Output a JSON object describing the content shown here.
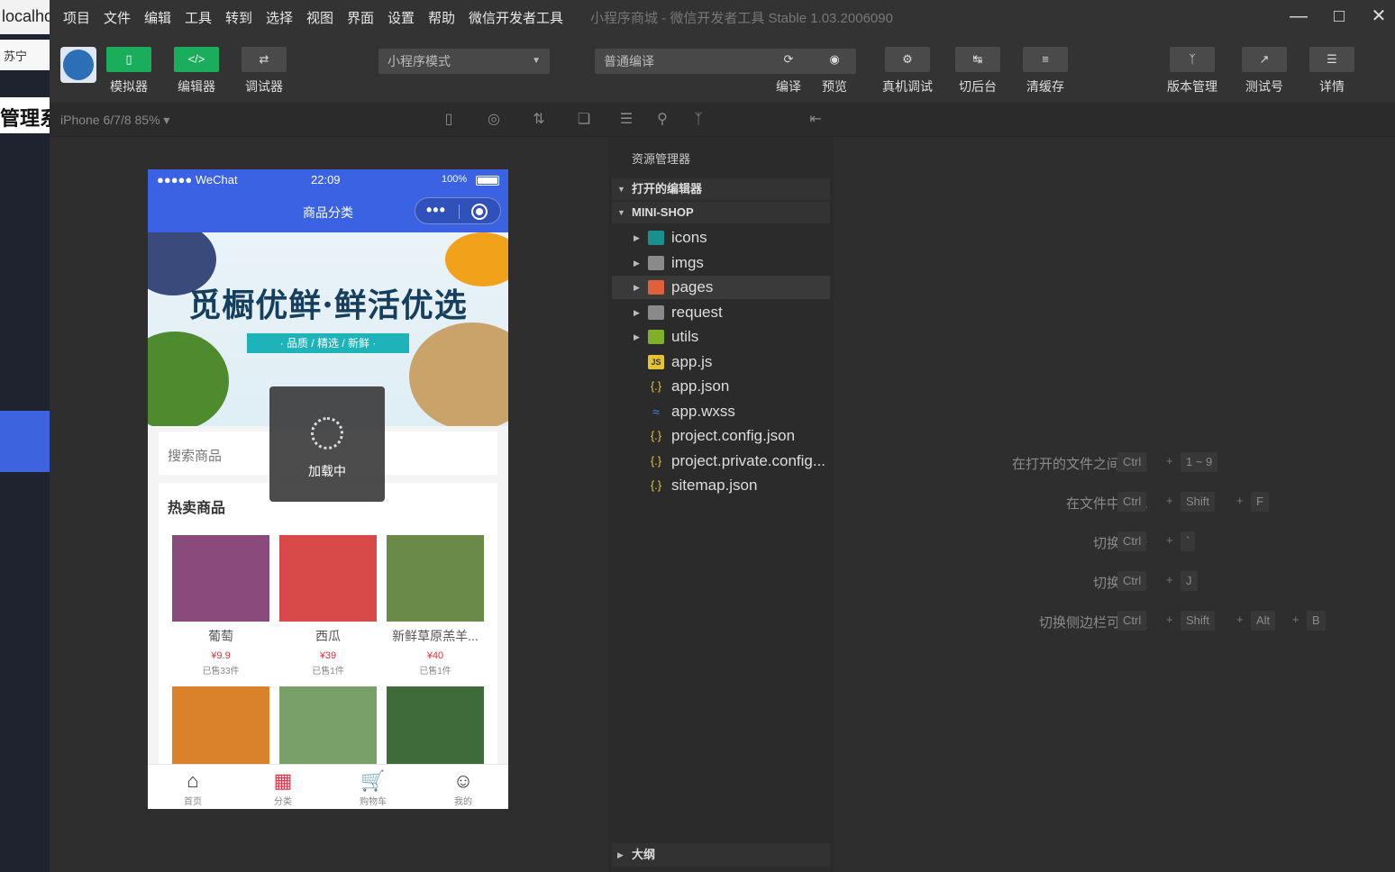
{
  "bg_window": {
    "tab_text": "localhost",
    "tab2_text": "苏宁",
    "heading": "管理系"
  },
  "menubar": {
    "items": [
      "项目",
      "文件",
      "编辑",
      "工具",
      "转到",
      "选择",
      "视图",
      "界面",
      "设置",
      "帮助",
      "微信开发者工具"
    ],
    "title": "小程序商城 - 微信开发者工具 Stable 1.03.2006090"
  },
  "toolbar": {
    "simulator_label": "模拟器",
    "editor_label": "编辑器",
    "debugger_label": "调试器",
    "mode_select": "小程序模式",
    "compile_select": "普通编译",
    "compile_label": "编译",
    "preview_label": "预览",
    "remote_debug_label": "真机调试",
    "backend_label": "切后台",
    "clear_cache_label": "清缓存",
    "version_label": "版本管理",
    "test_label": "测试号",
    "details_label": "详情"
  },
  "subbar": {
    "device": "iPhone 6/7/8 85% ▾"
  },
  "phone": {
    "status_left": "●●●●● WeChat",
    "status_time": "22:09",
    "status_battery": "100%",
    "nav_title": "商品分类",
    "banner_headline": "觅橱优鲜·鲜活优选",
    "banner_ribbon": "· 品质 / 精选 / 新鲜 ·",
    "search_placeholder": "搜索商品",
    "hot_title": "热卖商品",
    "loading_text": "加载中",
    "products": [
      {
        "name": "葡萄",
        "price": "¥9.9",
        "sold": "已售33件",
        "color": "#8a4a7c"
      },
      {
        "name": "西瓜",
        "price": "¥39",
        "sold": "已售1件",
        "color": "#d84a4a"
      },
      {
        "name": "新鲜草原羔羊...",
        "price": "¥40",
        "sold": "已售1件",
        "color": "#6a8a4a"
      },
      {
        "name": "",
        "price": "",
        "sold": "",
        "color": "#d9822b"
      },
      {
        "name": "",
        "price": "",
        "sold": "",
        "color": "#7aa06a"
      },
      {
        "name": "",
        "price": "",
        "sold": "",
        "color": "#3f6a3a"
      }
    ],
    "tabs": [
      {
        "label": "首页",
        "icon": "home-icon"
      },
      {
        "label": "分类",
        "icon": "category-icon"
      },
      {
        "label": "购物车",
        "icon": "cart-icon"
      },
      {
        "label": "我的",
        "icon": "user-icon"
      }
    ]
  },
  "explorer": {
    "header": "资源管理器",
    "open_editors": "打开的编辑器",
    "project": "MINI-SHOP",
    "tree": [
      {
        "name": "icons",
        "type": "folder-teal"
      },
      {
        "name": "imgs",
        "type": "folder"
      },
      {
        "name": "pages",
        "type": "folder-orange"
      },
      {
        "name": "request",
        "type": "folder"
      },
      {
        "name": "utils",
        "type": "folder-lime"
      },
      {
        "name": "app.js",
        "type": "js"
      },
      {
        "name": "app.json",
        "type": "json"
      },
      {
        "name": "app.wxss",
        "type": "css"
      },
      {
        "name": "project.config.json",
        "type": "json"
      },
      {
        "name": "project.private.config...",
        "type": "json"
      },
      {
        "name": "sitemap.json",
        "type": "json"
      }
    ],
    "outline": "大纲"
  },
  "shortcuts": [
    {
      "label": "在打开的文件之间切换",
      "keys": [
        "Ctrl",
        "1 ~ 9"
      ]
    },
    {
      "label": "在文件中查找",
      "keys": [
        "Ctrl",
        "Shift",
        "F"
      ]
    },
    {
      "label": "切换终端",
      "keys": [
        "Ctrl",
        "`"
      ]
    },
    {
      "label": "切换面板",
      "keys": [
        "Ctrl",
        "J"
      ]
    },
    {
      "label": "切换侧边栏可见性",
      "keys": [
        "Ctrl",
        "Shift",
        "Alt",
        "B"
      ]
    }
  ]
}
